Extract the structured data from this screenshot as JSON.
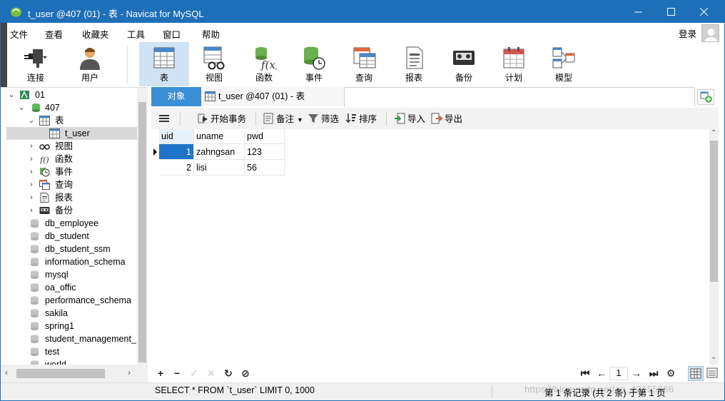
{
  "window": {
    "title": "t_user @407 (01) - 表 - Navicat for MySQL"
  },
  "menu": {
    "items": [
      "文件",
      "查看",
      "收藏夹",
      "工具",
      "窗口",
      "帮助"
    ],
    "login": "登录"
  },
  "toolbar": {
    "buttons": [
      {
        "label": "连接",
        "icon": "connection-icon"
      },
      {
        "label": "用户",
        "icon": "user-icon"
      },
      {
        "label": "表",
        "icon": "table-icon"
      },
      {
        "label": "视图",
        "icon": "view-icon"
      },
      {
        "label": "函数",
        "icon": "function-icon"
      },
      {
        "label": "事件",
        "icon": "event-icon"
      },
      {
        "label": "查询",
        "icon": "query-icon"
      },
      {
        "label": "报表",
        "icon": "report-icon"
      },
      {
        "label": "备份",
        "icon": "backup-icon"
      },
      {
        "label": "计划",
        "icon": "schedule-icon"
      },
      {
        "label": "模型",
        "icon": "model-icon"
      }
    ],
    "active": "表"
  },
  "tree": {
    "connection": "01",
    "database": "407",
    "group_table": "表",
    "table_selected": "t_user",
    "groups": [
      "视图",
      "函数",
      "事件",
      "查询",
      "报表",
      "备份"
    ],
    "databases": [
      "db_employee",
      "db_student",
      "db_student_ssm",
      "information_schema",
      "mysql",
      "oa_offic",
      "performance_schema",
      "sakila",
      "spring1",
      "student_management_",
      "test",
      "world"
    ]
  },
  "tabs": {
    "object_tab": "对象",
    "table_tab": "t_user @407 (01) - 表"
  },
  "subtoolbar": {
    "begin_tx": "开始事务",
    "note": "备注",
    "filter": "筛选",
    "sort": "排序",
    "import": "导入",
    "export": "导出"
  },
  "grid": {
    "columns": [
      "uid",
      "uname",
      "pwd"
    ],
    "rows": [
      [
        "1",
        "zahngsan",
        "123"
      ],
      [
        "2",
        "lisi",
        "56"
      ]
    ]
  },
  "nav": {
    "page": "1"
  },
  "status": {
    "sql": "SELECT * FROM `t_user` LIMIT 0, 1000",
    "records": "第 1 条记录 (共 2 条) 于第 1 页",
    "watermark": "https://blog.csdn.net/qq_43155866"
  }
}
